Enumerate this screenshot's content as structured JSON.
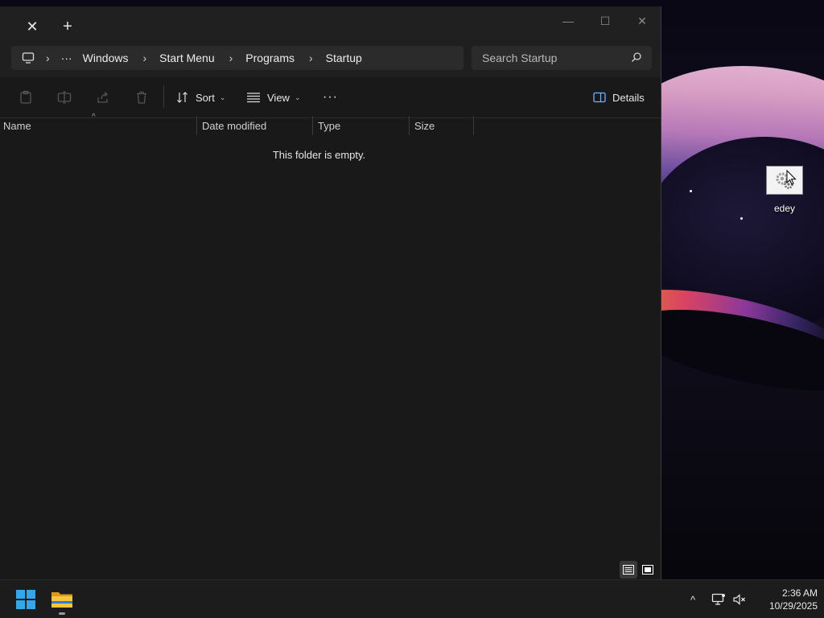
{
  "window": {
    "tab_close": "✕",
    "new_tab": "+",
    "controls": {
      "minimize": "—",
      "maximize": "☐",
      "close": "✕"
    }
  },
  "address": {
    "overflow": "···",
    "segments": [
      "Windows",
      "Start Menu",
      "Programs",
      "Startup"
    ]
  },
  "search": {
    "placeholder": "Search Startup"
  },
  "toolbar": {
    "sort_label": "Sort",
    "view_label": "View",
    "more_label": "···",
    "details_label": "Details"
  },
  "columns": [
    "Name",
    "Date modified",
    "Type",
    "Size"
  ],
  "content": {
    "empty_message": "This folder is empty."
  },
  "desktop": {
    "icon_label": "edey"
  },
  "taskbar": {
    "time": "2:36 AM",
    "date": "10/29/2025",
    "overflow_caret": "^"
  },
  "colors": {
    "accent": "#0078d4",
    "window_bg": "#191919",
    "taskbar_bg": "#1c1c1c",
    "folder_yellow": "#f0b429"
  }
}
